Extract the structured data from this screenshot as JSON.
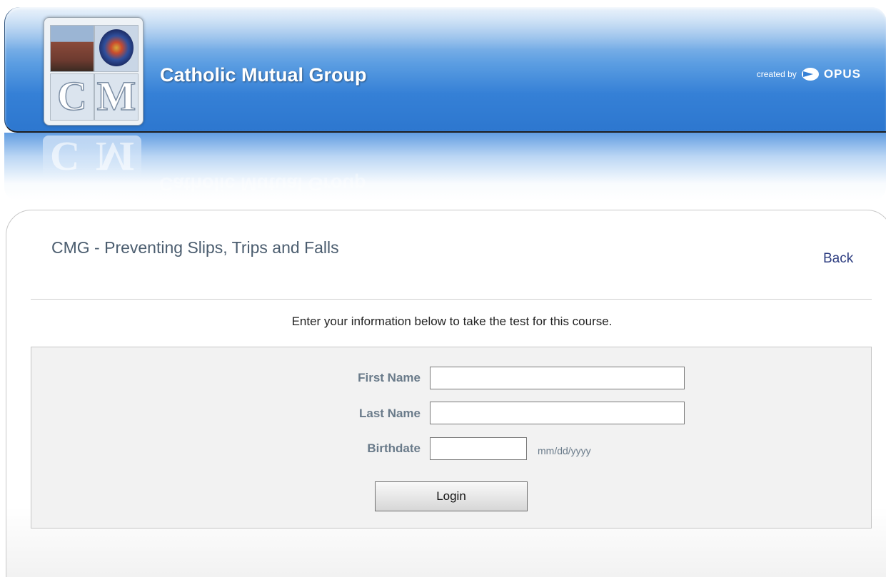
{
  "header": {
    "brand_title": "Catholic Mutual Group",
    "logo_letters": [
      "C",
      "M"
    ],
    "created_by_label": "created by",
    "opus_label": "OPUS"
  },
  "course": {
    "title": "CMG - Preventing Slips, Trips and Falls",
    "back_label": "Back"
  },
  "instructions": "Enter your information below to take the test for this course.",
  "form": {
    "first_name_label": "First Name",
    "first_name_value": "",
    "last_name_label": "Last Name",
    "last_name_value": "",
    "birthdate_label": "Birthdate",
    "birthdate_value": "",
    "birthdate_hint": "mm/dd/yyyy",
    "login_label": "Login"
  },
  "colors": {
    "header_blue": "#3580d6",
    "label_gray": "#6a7b8a",
    "link_blue": "#2d3d80",
    "title_gray": "#4b5d6f"
  }
}
